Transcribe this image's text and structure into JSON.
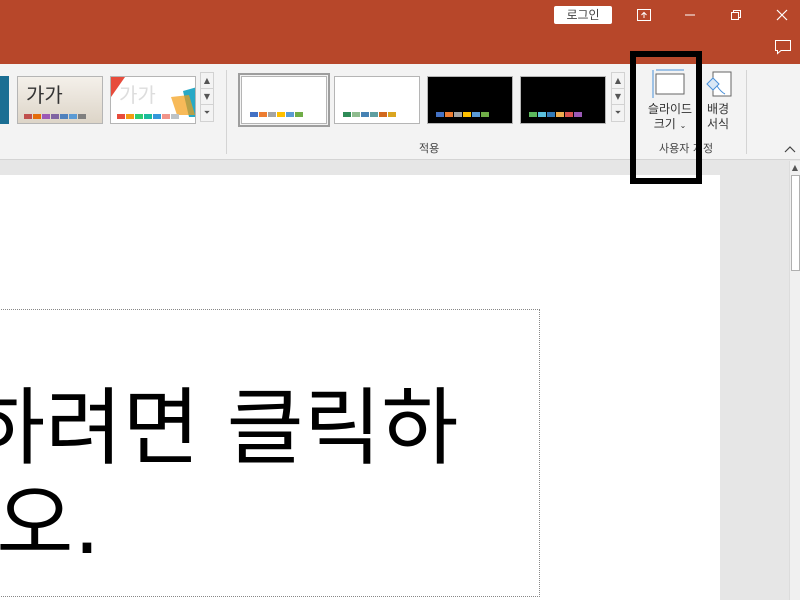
{
  "titlebar": {
    "login_label": "로그인",
    "accent_color": "#b7472a"
  },
  "ribbon": {
    "theme_thumbnails": [
      {
        "text": "",
        "colors": [
          "#1b6e93"
        ]
      },
      {
        "text": "가가",
        "colors": [
          "#c0504d",
          "#e46c0a",
          "#9b59b6",
          "#8064a2",
          "#4f81bd",
          "#5b9bd5",
          "#7f7f7f"
        ]
      },
      {
        "text": "가가",
        "colors": [
          "#e74c3c",
          "#f39c12",
          "#2ecc71",
          "#1abc9c",
          "#3498db",
          "#f1948a",
          "#bdc3c7"
        ]
      }
    ],
    "variants": [
      {
        "background": "#ffffff",
        "selected": true,
        "colors": [
          "#4472c4",
          "#ed7d31",
          "#a5a5a5",
          "#ffc000",
          "#5b9bd5",
          "#70ad47"
        ]
      },
      {
        "background": "#ffffff",
        "selected": false,
        "colors": [
          "#2e8b57",
          "#8fbc8f",
          "#4682b4",
          "#5f9ea0",
          "#d2691e",
          "#daa520"
        ]
      },
      {
        "background": "#000000",
        "selected": false,
        "colors": [
          "#4472c4",
          "#ed7d31",
          "#a5a5a5",
          "#ffc000",
          "#5b9bd5",
          "#70ad47"
        ]
      },
      {
        "background": "#000000",
        "selected": false,
        "colors": [
          "#5cb85c",
          "#5bc0de",
          "#337ab7",
          "#f0ad4e",
          "#d9534f",
          "#9b59b6"
        ]
      }
    ],
    "apply_group_label": "적용",
    "customize_group_label": "사용자 지정",
    "slide_size_label_line1": "슬라이드",
    "slide_size_label_line2": "크기",
    "format_background_line1": "배경",
    "format_background_line2": "서식"
  },
  "slide": {
    "title_line1": "하려면 클릭하",
    "title_line2": "|오."
  }
}
